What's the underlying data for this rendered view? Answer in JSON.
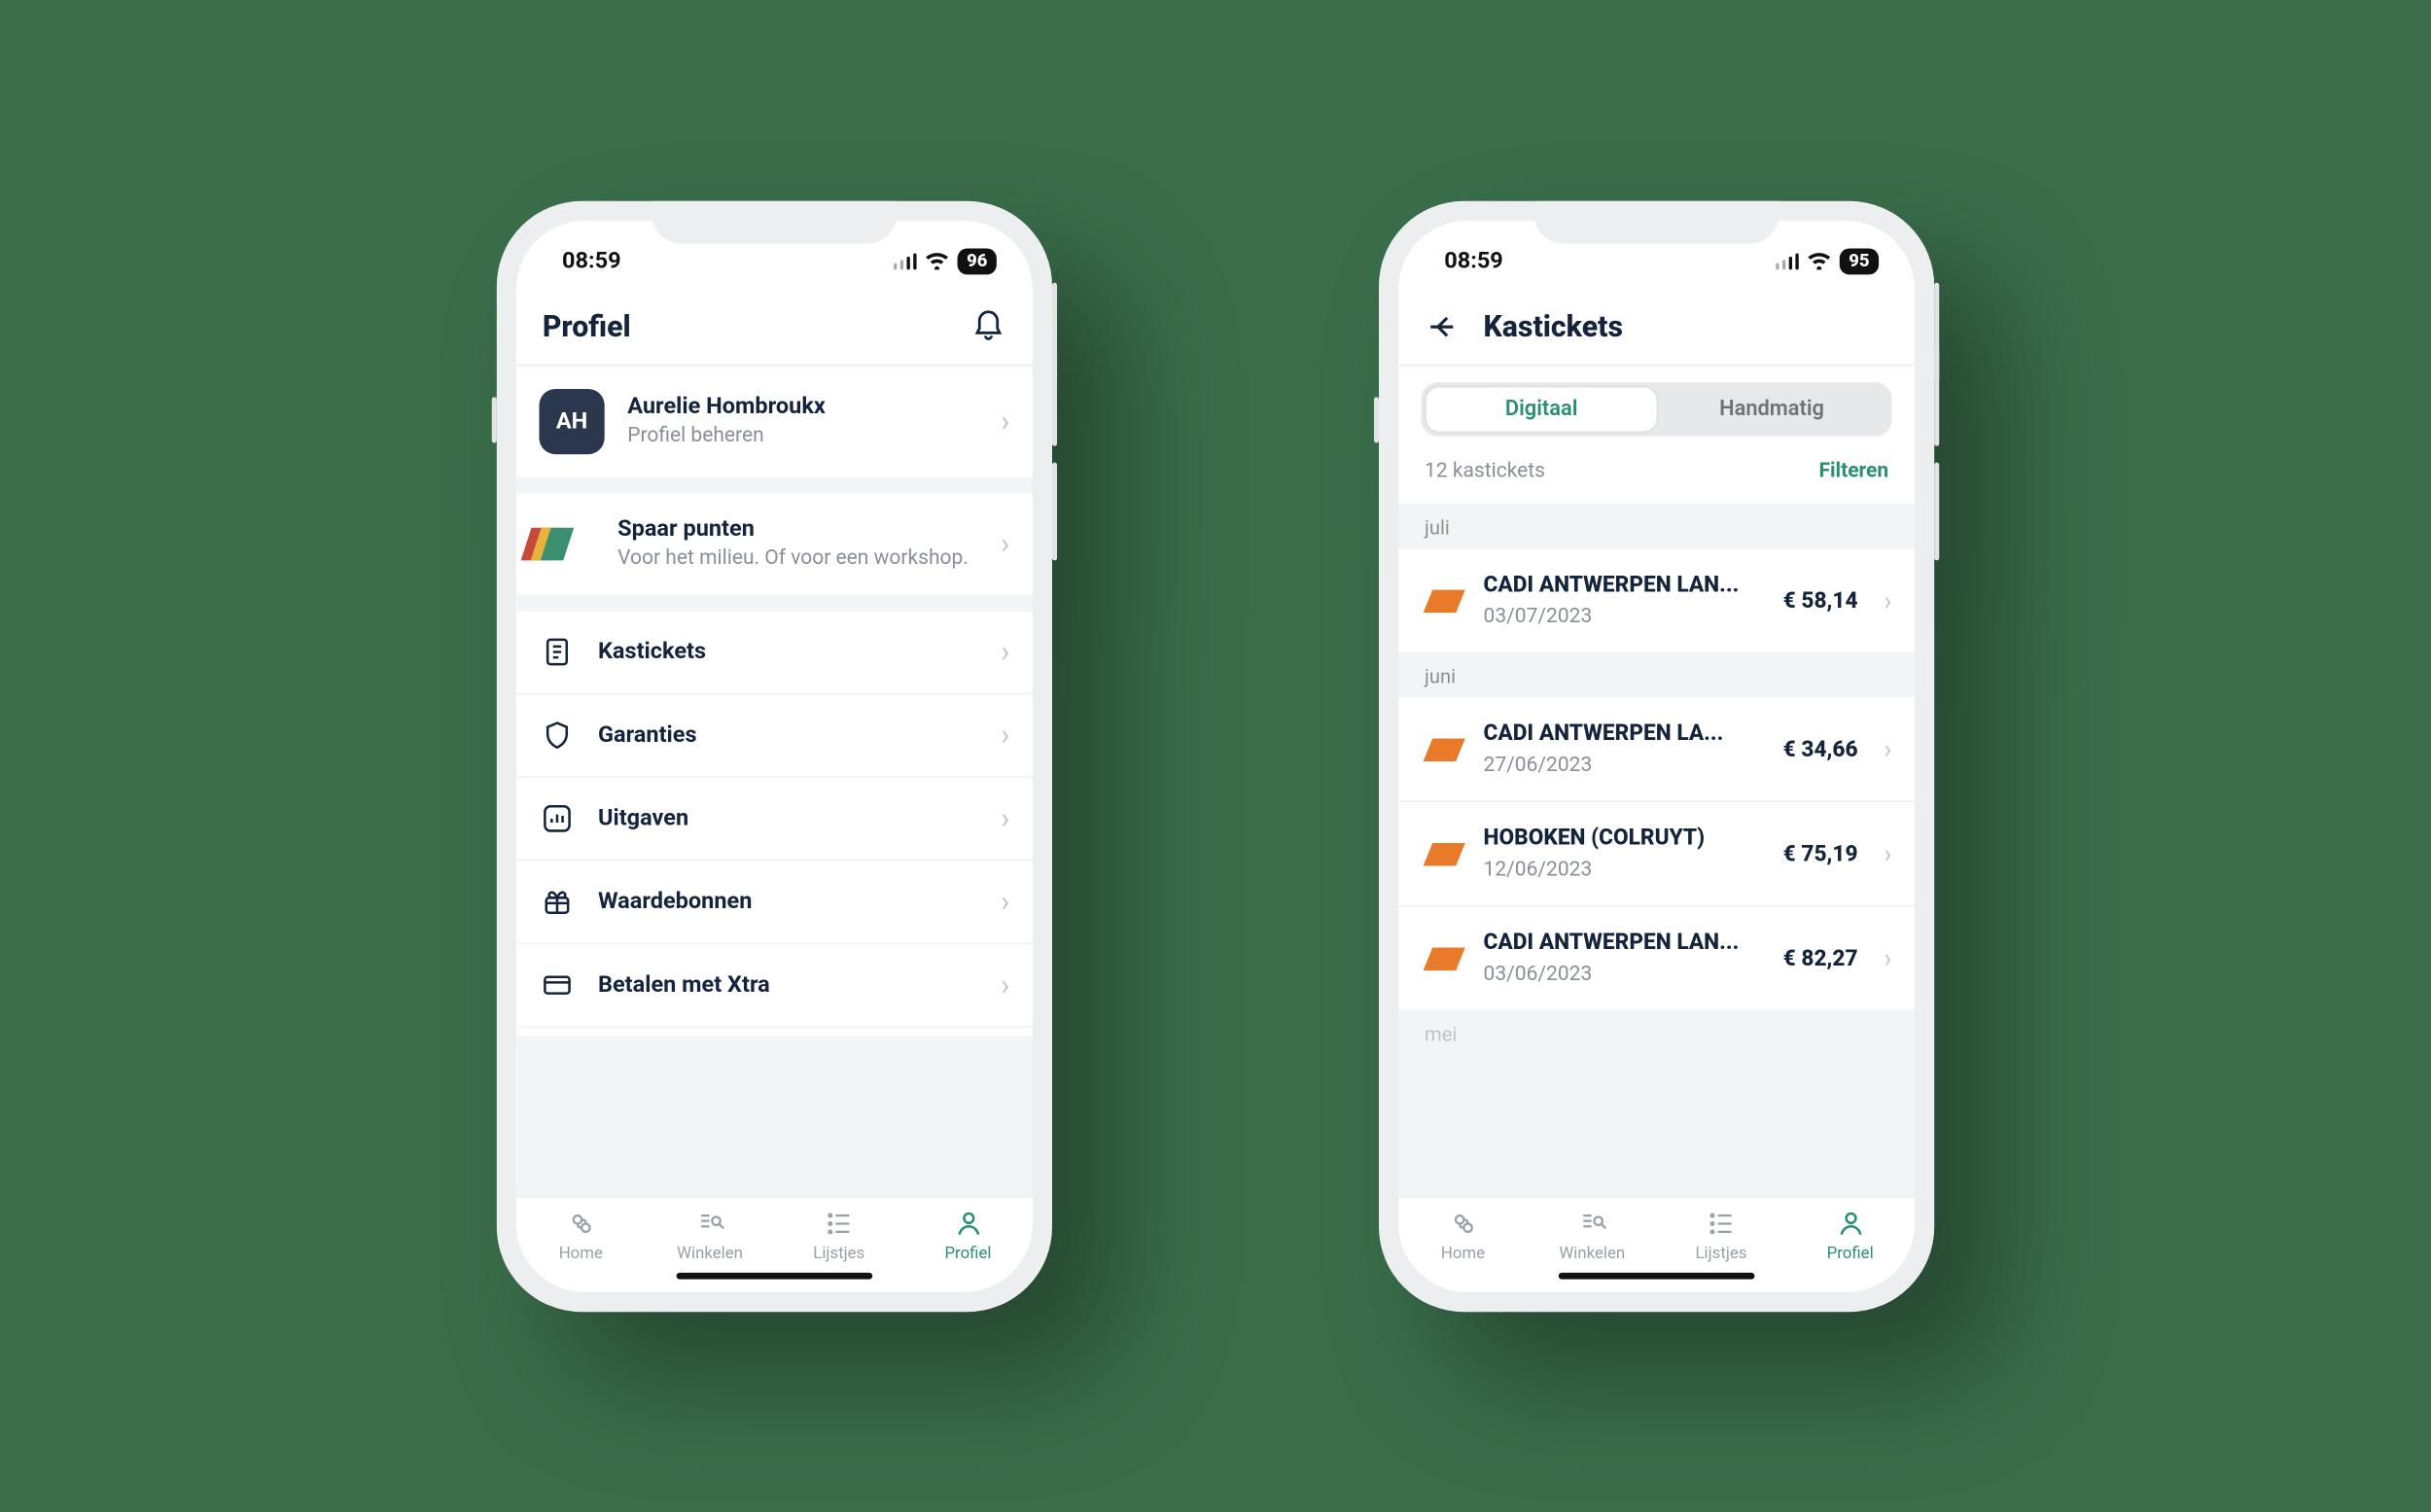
{
  "left": {
    "status": {
      "time": "08:59",
      "battery": "96"
    },
    "header": {
      "title": "Profiel"
    },
    "profile": {
      "avatar_initials": "AH",
      "name": "Aurelie Hombroukx",
      "subtitle": "Profiel beheren"
    },
    "points": {
      "title": "Spaar punten",
      "subtitle": "Voor het milieu. Of voor een workshop."
    },
    "menu": {
      "kastickets": "Kastickets",
      "garanties": "Garanties",
      "uitgaven": "Uitgaven",
      "waardebonnen": "Waardebonnen",
      "betalen": "Betalen met Xtra"
    },
    "tabs": {
      "home": "Home",
      "winkelen": "Winkelen",
      "lijstjes": "Lijstjes",
      "profiel": "Profiel"
    }
  },
  "right": {
    "status": {
      "time": "08:59",
      "battery": "95"
    },
    "header": {
      "title": "Kastickets"
    },
    "segmented": {
      "digital": "Digitaal",
      "manual": "Handmatig"
    },
    "meta": {
      "count": "12 kastickets",
      "filter_label": "Filteren"
    },
    "sections": {
      "juli": {
        "label": "juli",
        "items": [
          {
            "title": "CADI ANTWERPEN LAN...",
            "date": "03/07/2023",
            "amount": "€ 58,14"
          }
        ]
      },
      "juni": {
        "label": "juni",
        "items": [
          {
            "title": "CADI ANTWERPEN LA...",
            "date": "27/06/2023",
            "amount": "€ 34,66"
          },
          {
            "title": "HOBOKEN (COLRUYT)",
            "date": "12/06/2023",
            "amount": "€ 75,19"
          },
          {
            "title": "CADI ANTWERPEN LAN...",
            "date": "03/06/2023",
            "amount": "€ 82,27"
          }
        ]
      },
      "mei": {
        "label": "mei"
      }
    },
    "tabs": {
      "home": "Home",
      "winkelen": "Winkelen",
      "lijstjes": "Lijstjes",
      "profiel": "Profiel"
    }
  }
}
